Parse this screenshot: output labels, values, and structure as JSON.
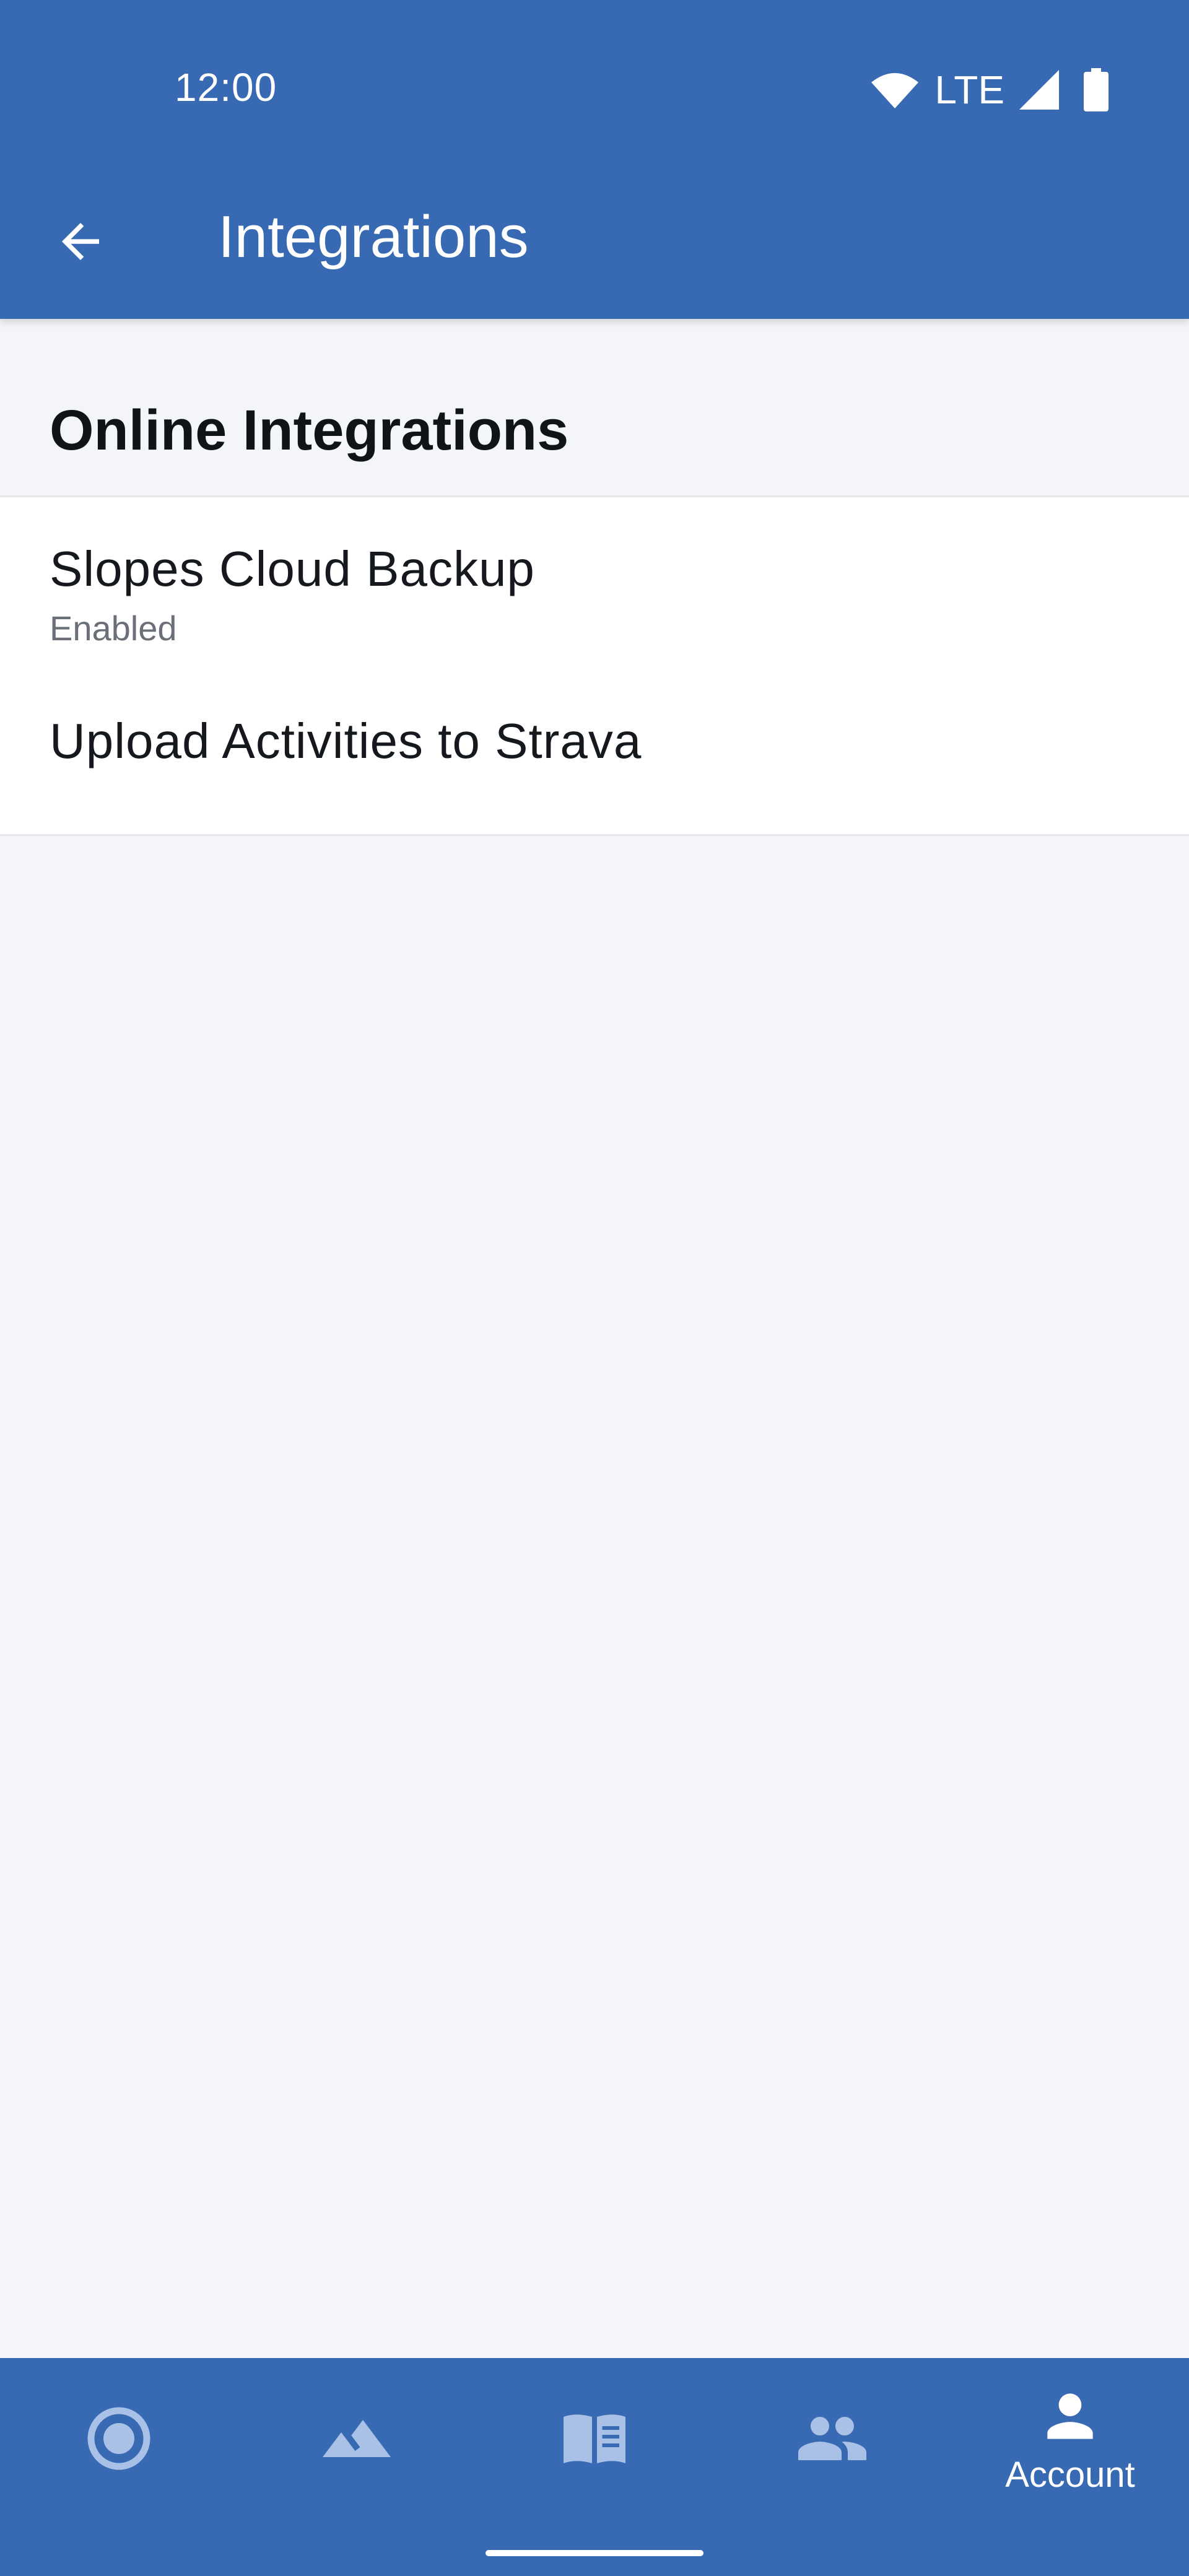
{
  "status_bar": {
    "time": "12:00",
    "network": "LTE"
  },
  "app_bar": {
    "title": "Integrations"
  },
  "section": {
    "title": "Online Integrations"
  },
  "items": [
    {
      "title": "Slopes Cloud Backup",
      "subtitle": "Enabled"
    },
    {
      "title": "Upload Activities to Strava"
    }
  ],
  "bottom_nav": {
    "items": [
      {
        "icon": "record-icon",
        "label": ""
      },
      {
        "icon": "mountain-icon",
        "label": ""
      },
      {
        "icon": "book-icon",
        "label": ""
      },
      {
        "icon": "people-icon",
        "label": ""
      },
      {
        "icon": "person-icon",
        "label": "Account",
        "selected": true
      }
    ]
  },
  "colors": {
    "primary": "#386ab3",
    "background": "#f4f5f9",
    "nav_inactive_icon": "#a9c1e6",
    "nav_active": "#ffffff"
  }
}
